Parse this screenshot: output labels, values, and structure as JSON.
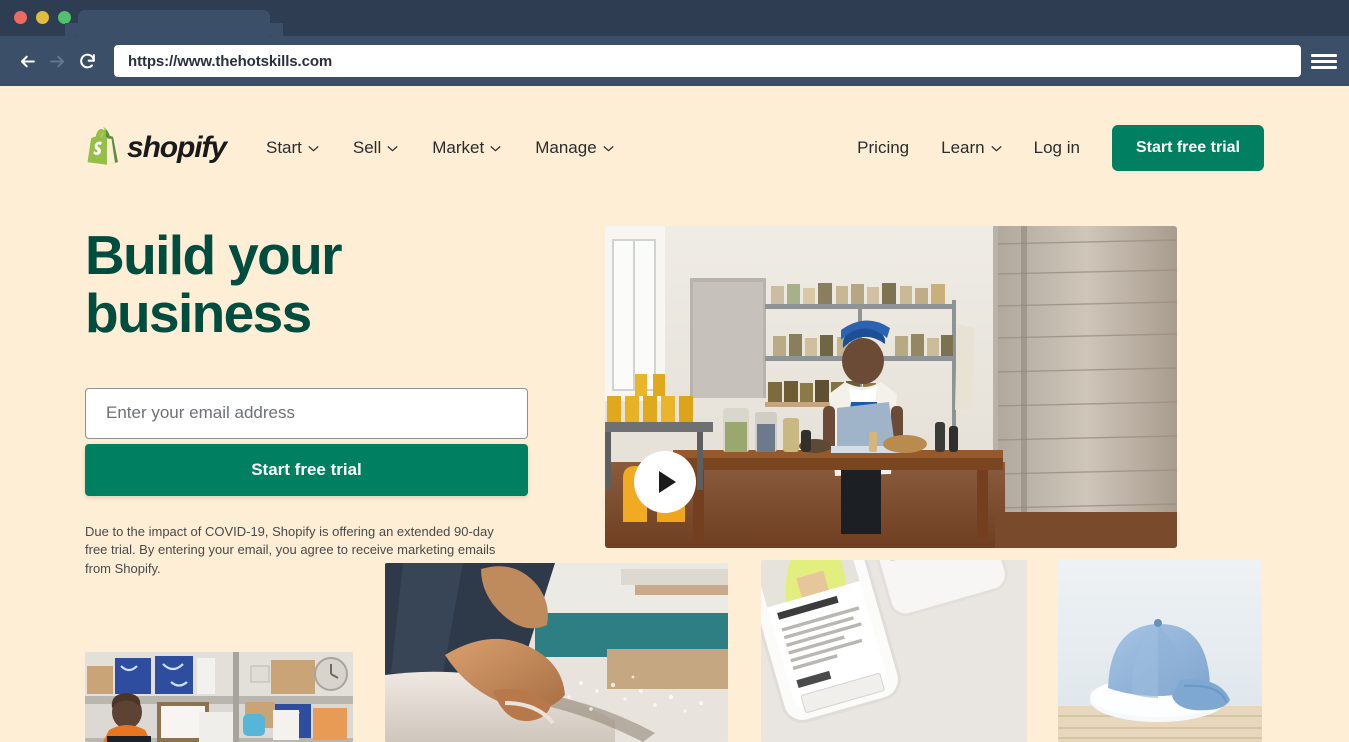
{
  "browser": {
    "url": "https://www.thehotskills.com",
    "back_icon": "arrow-left-icon",
    "forward_icon": "arrow-right-icon",
    "reload_icon": "reload-icon",
    "menu_icon": "hamburger-menu-icon",
    "traffic_lights": [
      "close",
      "minimize",
      "maximize"
    ]
  },
  "site": {
    "brand": {
      "name": "shopify",
      "logo_icon": "shopify-bag-icon",
      "logo_color": "#95bf47",
      "logo_dark": "#5e8e3e"
    },
    "nav_left": [
      {
        "label": "Start",
        "has_menu": true
      },
      {
        "label": "Sell",
        "has_menu": true
      },
      {
        "label": "Market",
        "has_menu": true
      },
      {
        "label": "Manage",
        "has_menu": true
      }
    ],
    "nav_right": [
      {
        "label": "Pricing",
        "has_menu": false
      },
      {
        "label": "Learn",
        "has_menu": true
      },
      {
        "label": "Log in",
        "has_menu": false
      }
    ],
    "nav_cta": "Start free trial"
  },
  "hero": {
    "title": "Build your business",
    "email_placeholder": "Enter your email address",
    "email_value": "",
    "cta_label": "Start free trial",
    "disclaimer": "Due to the impact of COVID-19, Shopify is offering an extended 90-day free trial. By entering your email, you agree to receive marketing emails from Shopify.",
    "video": {
      "alt": "Woman working on laptop in an apothecary workshop with shelves of jars",
      "play_icon": "play-icon"
    }
  },
  "gallery": [
    {
      "alt": "Woman in orange top packing orders at warehouse shelving"
    },
    {
      "alt": "Hands sanding a surfboard with dust"
    },
    {
      "alt": "Smartphone displaying an online store collection page"
    },
    {
      "alt": "Light blue baseball cap on a white plate on wood"
    }
  ],
  "colors": {
    "page_background": "#fdeed5",
    "brand_green": "#008060",
    "heading_green": "#004c3f",
    "chrome_titlebar": "#2e3d52",
    "chrome_toolbar": "#3c4f68"
  }
}
